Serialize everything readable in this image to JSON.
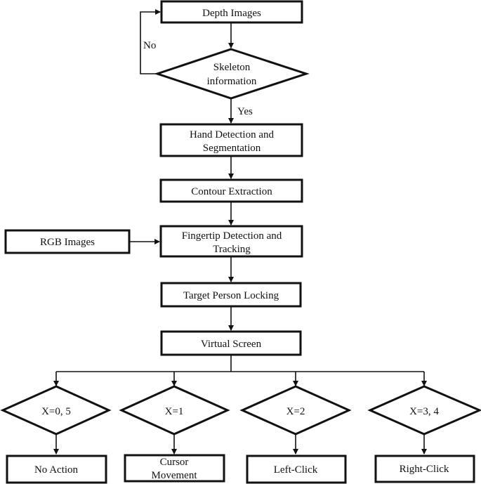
{
  "diagram": {
    "type": "flowchart",
    "nodes": {
      "depth_images": {
        "label": [
          "Depth Images"
        ],
        "shape": "process"
      },
      "skeleton": {
        "label": [
          "Skeleton",
          "information"
        ],
        "shape": "decision"
      },
      "hand_detection": {
        "label": [
          "Hand Detection and",
          "Segmentation"
        ],
        "shape": "process"
      },
      "contour": {
        "label": [
          "Contour Extraction"
        ],
        "shape": "process"
      },
      "rgb_images": {
        "label": [
          "RGB Images"
        ],
        "shape": "process"
      },
      "fingertip": {
        "label": [
          "Fingertip Detection and",
          "Tracking"
        ],
        "shape": "process"
      },
      "target_person": {
        "label": [
          "Target Person Locking"
        ],
        "shape": "process"
      },
      "virtual_screen": {
        "label": [
          "Virtual Screen"
        ],
        "shape": "process"
      },
      "cond_x05": {
        "label": [
          "X=0, 5"
        ],
        "shape": "decision"
      },
      "cond_x1": {
        "label": [
          "X=1"
        ],
        "shape": "decision"
      },
      "cond_x2": {
        "label": [
          "X=2"
        ],
        "shape": "decision"
      },
      "cond_x34": {
        "label": [
          "X=3, 4"
        ],
        "shape": "decision"
      },
      "no_action": {
        "label": [
          "No Action"
        ],
        "shape": "process"
      },
      "cursor_movement": {
        "label": [
          "Cursor",
          "Movement"
        ],
        "shape": "process"
      },
      "left_click": {
        "label": [
          "Left-Click"
        ],
        "shape": "process"
      },
      "right_click": {
        "label": [
          "Right-Click"
        ],
        "shape": "process"
      }
    },
    "edge_labels": {
      "no": "No",
      "yes": "Yes"
    },
    "edges": [
      {
        "from": "depth_images",
        "to": "skeleton"
      },
      {
        "from": "skeleton",
        "to": "depth_images",
        "label": "No"
      },
      {
        "from": "skeleton",
        "to": "hand_detection",
        "label": "Yes"
      },
      {
        "from": "hand_detection",
        "to": "contour"
      },
      {
        "from": "contour",
        "to": "fingertip"
      },
      {
        "from": "rgb_images",
        "to": "fingertip"
      },
      {
        "from": "fingertip",
        "to": "target_person"
      },
      {
        "from": "target_person",
        "to": "virtual_screen"
      },
      {
        "from": "virtual_screen",
        "to": "cond_x05"
      },
      {
        "from": "virtual_screen",
        "to": "cond_x1"
      },
      {
        "from": "virtual_screen",
        "to": "cond_x2"
      },
      {
        "from": "virtual_screen",
        "to": "cond_x34"
      },
      {
        "from": "cond_x05",
        "to": "no_action"
      },
      {
        "from": "cond_x1",
        "to": "cursor_movement"
      },
      {
        "from": "cond_x2",
        "to": "left_click"
      },
      {
        "from": "cond_x34",
        "to": "right_click"
      }
    ]
  }
}
